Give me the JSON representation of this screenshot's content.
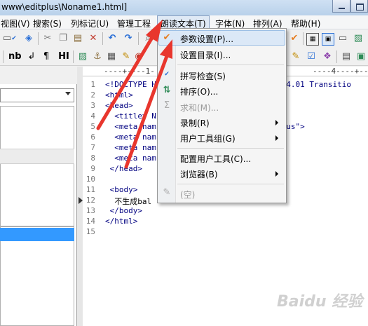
{
  "window": {
    "title": "www\\editplus\\Noname1.html]"
  },
  "menubar": {
    "items": [
      "视图(V)",
      "搜索(S)",
      "列标记(U)",
      "管理工程",
      "朗读文本(T)",
      "字体(N)",
      "排列(A)",
      "帮助(H)"
    ],
    "active": "朗读文本(T)"
  },
  "toolbar2": {
    "nb": "nb",
    "para": "¶",
    "hi": "HI"
  },
  "editor": {
    "ruler": "----+----1-                                  ----4----+----5",
    "line_numbers": [
      "1",
      "2",
      "3",
      "4",
      "5",
      "6",
      "7",
      "8",
      "9",
      "10",
      "11",
      "12",
      "13",
      "14",
      "15"
    ],
    "lines": [
      "<!DOCTYPE H                         ML 4.01 Transitio",
      "<html>",
      "<head>",
      "  <title> N",
      "  <meta nam                         tPlus\">",
      "  <meta nam",
      "  <meta nam",
      "  <meta nam                         >",
      " </head>",
      "",
      " <body>",
      "  不生成bal",
      " </body>",
      "</html>",
      ""
    ]
  },
  "dropdown": {
    "items": [
      {
        "label": "参数设置(P)...",
        "submenu": false,
        "disabled": false,
        "icon": "checkmark-icon"
      },
      {
        "label": "设置目录(I)...",
        "submenu": false,
        "disabled": false,
        "icon": ""
      },
      {
        "label": "拼写检查(S)",
        "submenu": false,
        "disabled": false,
        "icon": "spellcheck-icon"
      },
      {
        "label": "排序(O)...",
        "submenu": false,
        "disabled": false,
        "icon": "sort-icon"
      },
      {
        "label": "求和(M)...",
        "submenu": false,
        "disabled": true,
        "icon": "sum-icon"
      },
      {
        "label": "录制(R)",
        "submenu": true,
        "disabled": false,
        "icon": ""
      },
      {
        "label": "用户工具组(G)",
        "submenu": true,
        "disabled": false,
        "icon": ""
      },
      {
        "label": "配置用户工具(C)...",
        "submenu": false,
        "disabled": false,
        "icon": ""
      },
      {
        "label": "浏览器(B)",
        "submenu": true,
        "disabled": false,
        "icon": ""
      },
      {
        "label": "(空)",
        "submenu": false,
        "disabled": true,
        "icon": "wrench-icon"
      }
    ]
  },
  "watermark": "Baidu 经验",
  "colors": {
    "highlight": "#3399ff",
    "arrow": "#e8362d",
    "code": "#000080"
  }
}
